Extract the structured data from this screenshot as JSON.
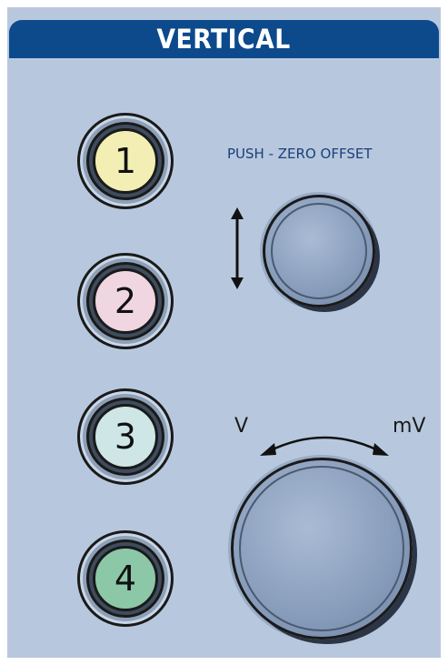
{
  "panel": {
    "title": "VERTICAL",
    "colors": {
      "panel_bg": "#b7c8de",
      "header_bg": "#0c4a8c",
      "label_text": "#1c3f7a"
    }
  },
  "channels": [
    {
      "label": "1",
      "color": "#f3efb4"
    },
    {
      "label": "2",
      "color": "#f0d6e0"
    },
    {
      "label": "3",
      "color": "#cfe6e6"
    },
    {
      "label": "4",
      "color": "#8cc8a8"
    }
  ],
  "offset_knob": {
    "label": "PUSH - ZERO OFFSET",
    "icon": "up-down-arrow-icon"
  },
  "scale_knob": {
    "left_unit": "V",
    "right_unit": "mV",
    "icon": "curved-double-arrow-icon"
  }
}
